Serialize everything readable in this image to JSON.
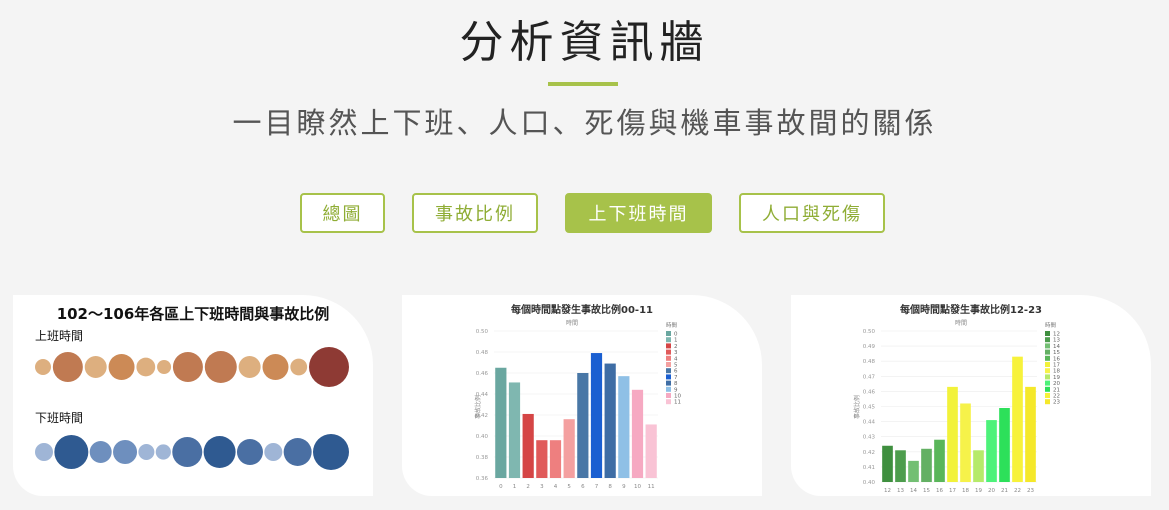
{
  "header": {
    "title": "分析資訊牆",
    "subtitle": "一目瞭然上下班、人口、死傷與機車事故間的關係"
  },
  "tabs": [
    {
      "label": "總圖",
      "active": false
    },
    {
      "label": "事故比例",
      "active": false
    },
    {
      "label": "上下班時間",
      "active": true
    },
    {
      "label": "人口與死傷",
      "active": false
    }
  ],
  "colors": {
    "accent": "#a7c24a"
  },
  "cards": {
    "bubble": {
      "title": "102～106年各區上下班時間與事故比例",
      "section_commute_out": "上班時間",
      "section_commute_home": "下班時間"
    },
    "bar1": {
      "title": "每個時間點發生事故比例00-11",
      "ylabel": "事故比例",
      "xlabel": "時間"
    },
    "bar2": {
      "title": "每個時間點發生事故比例12-23",
      "ylabel": "事故比例",
      "xlabel": "時間"
    }
  },
  "chart_data": [
    {
      "type": "scatter",
      "title": "102～106年各區上下班時間與事故比例",
      "series": [
        {
          "name": "上班時間",
          "values": [
            0.2,
            0.55,
            0.35,
            0.45,
            0.27,
            0.15,
            0.55,
            0.6,
            0.35,
            0.45,
            0.22,
            0.8
          ]
        },
        {
          "name": "下班時間",
          "values": [
            0.25,
            0.65,
            0.35,
            0.4,
            0.2,
            0.18,
            0.55,
            0.6,
            0.45,
            0.25,
            0.5,
            0.7
          ]
        }
      ]
    },
    {
      "type": "bar",
      "title": "每個時間點發生事故比例00-11",
      "xlabel": "時間",
      "ylabel": "事故比例",
      "categories": [
        "0",
        "1",
        "2",
        "3",
        "4",
        "5",
        "6",
        "7",
        "8",
        "9",
        "10",
        "11"
      ],
      "values": [
        0.465,
        0.451,
        0.421,
        0.396,
        0.396,
        0.416,
        0.46,
        0.479,
        0.469,
        0.457,
        0.444,
        0.411
      ],
      "ylim": [
        0.36,
        0.5
      ],
      "yticks": [
        "0.36",
        "0.38",
        "0.40",
        "0.42",
        "0.44",
        "0.46",
        "0.48",
        "0.50"
      ],
      "colors": [
        "#6aa7a0",
        "#7fb7b0",
        "#d54545",
        "#e05a5a",
        "#ee7f7f",
        "#f4a0a0",
        "#4977a6",
        "#1a5fd1",
        "#3e6da5",
        "#8fc0e6",
        "#f6a9c2",
        "#f9c3d5"
      ],
      "legend_title": "時間",
      "legend": "top-right"
    },
    {
      "type": "bar",
      "title": "每個時間點發生事故比例12-23",
      "xlabel": "時間",
      "ylabel": "事故比例",
      "categories": [
        "12",
        "13",
        "14",
        "15",
        "16",
        "17",
        "18",
        "19",
        "20",
        "21",
        "22",
        "23"
      ],
      "values": [
        0.424,
        0.421,
        0.414,
        0.422,
        0.428,
        0.463,
        0.452,
        0.421,
        0.441,
        0.449,
        0.483,
        0.463
      ],
      "ylim": [
        0.4,
        0.5
      ],
      "yticks": [
        "0.40",
        "0.41",
        "0.42",
        "0.43",
        "0.44",
        "0.45",
        "0.46",
        "0.47",
        "0.48",
        "0.49",
        "0.50"
      ],
      "colors": [
        "#3f8f3f",
        "#4d9d4d",
        "#73bf73",
        "#63b063",
        "#5ab65a",
        "#f2f23a",
        "#f6f24a",
        "#b6ea6a",
        "#4df27a",
        "#2de05a",
        "#f7f23b",
        "#f5e82a"
      ],
      "legend_title": "時間",
      "legend": "top-right"
    }
  ]
}
